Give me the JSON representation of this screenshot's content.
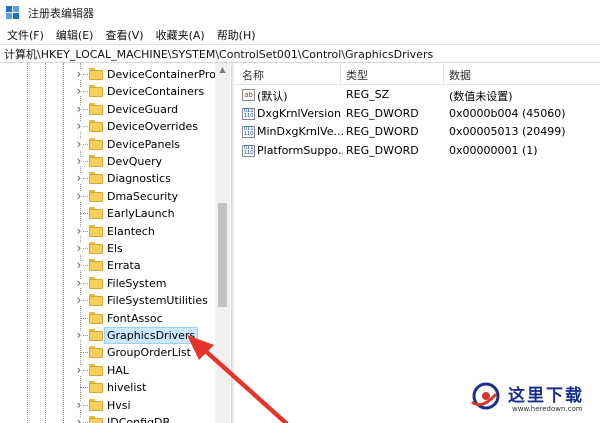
{
  "window": {
    "title": "注册表编辑器"
  },
  "menu": [
    {
      "label": "文件(F)"
    },
    {
      "label": "编辑(E)"
    },
    {
      "label": "查看(V)"
    },
    {
      "label": "收藏夹(A)"
    },
    {
      "label": "帮助(H)"
    }
  ],
  "address": {
    "path": "计算机\\HKEY_LOCAL_MACHINE\\SYSTEM\\ControlSet001\\Control\\GraphicsDrivers"
  },
  "tree": {
    "items": [
      {
        "label": "DeviceContainerPrope",
        "expandable": true
      },
      {
        "label": "DeviceContainers",
        "expandable": true
      },
      {
        "label": "DeviceGuard",
        "expandable": true
      },
      {
        "label": "DeviceOverrides",
        "expandable": true
      },
      {
        "label": "DevicePanels",
        "expandable": true
      },
      {
        "label": "DevQuery",
        "expandable": true
      },
      {
        "label": "Diagnostics",
        "expandable": true
      },
      {
        "label": "DmaSecurity",
        "expandable": true
      },
      {
        "label": "EarlyLaunch",
        "expandable": false
      },
      {
        "label": "Elantech",
        "expandable": true
      },
      {
        "label": "Els",
        "expandable": true
      },
      {
        "label": "Errata",
        "expandable": true
      },
      {
        "label": "FileSystem",
        "expandable": true
      },
      {
        "label": "FileSystemUtilities",
        "expandable": true
      },
      {
        "label": "FontAssoc",
        "expandable": false
      },
      {
        "label": "GraphicsDrivers",
        "expandable": true,
        "selected": true
      },
      {
        "label": "GroupOrderList",
        "expandable": false
      },
      {
        "label": "HAL",
        "expandable": true
      },
      {
        "label": "hivelist",
        "expandable": false
      },
      {
        "label": "Hvsi",
        "expandable": true
      },
      {
        "label": "IDConfigDB",
        "expandable": true
      }
    ]
  },
  "list": {
    "columns": {
      "name": "名称",
      "type": "类型",
      "data": "数据"
    },
    "rows": [
      {
        "icon": "string-value-icon",
        "icon_text": "ab",
        "name": "(默认)",
        "type": "REG_SZ",
        "data": "(数值未设置)"
      },
      {
        "icon": "binary-value-icon",
        "icon_text": "011\n110",
        "name": "DxgKrnlVersion",
        "type": "REG_DWORD",
        "data": "0x0000b004 (45060)"
      },
      {
        "icon": "binary-value-icon",
        "icon_text": "011\n110",
        "name": "MinDxgKrnlVe...",
        "type": "REG_DWORD",
        "data": "0x00005013 (20499)"
      },
      {
        "icon": "binary-value-icon",
        "icon_text": "011\n110",
        "name": "PlatformSuppo...",
        "type": "REG_DWORD",
        "data": "0x00000001 (1)"
      }
    ]
  },
  "colors": {
    "selection_bg": "#cce8ff",
    "folder": "#f7cf5c",
    "arrow": "#e8332a",
    "watermark_blue": "#1a2f8a"
  },
  "watermark": {
    "title": "这里下载",
    "url": "www.heredown.com"
  }
}
